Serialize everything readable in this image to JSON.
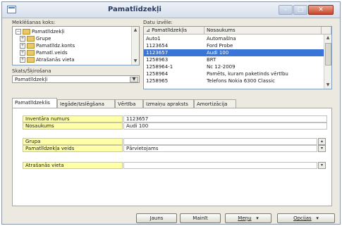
{
  "window": {
    "title": "Pamatlīdzekļi"
  },
  "left": {
    "tree_label": "Meklēšanas koks:",
    "tree_items": [
      {
        "label": "Pamatlīdzekļi",
        "expander": "−"
      },
      {
        "label": "Grupe",
        "expander": "+"
      },
      {
        "label": "Pamatlīdz.konts",
        "expander": "+"
      },
      {
        "label": "Pamatl.veids",
        "expander": "+"
      },
      {
        "label": "Atrašanās vieta",
        "expander": "+"
      }
    ],
    "sort_label": "Skats/Šķirošana",
    "sort_value": "Pamatlīdzekļi"
  },
  "list": {
    "label": "Datu izvēle:",
    "headers": [
      "Pamatlīdzekļis",
      "Nosaukums"
    ],
    "rows": [
      {
        "id": "Auto1",
        "name": "Automašīna"
      },
      {
        "id": "1123654",
        "name": "Ford Probe"
      },
      {
        "id": "1123657",
        "name": "Audi 100"
      },
      {
        "id": "1258963",
        "name": "BRT"
      },
      {
        "id": "1258964-1",
        "name": "Nc 12-2009"
      },
      {
        "id": "1258964",
        "name": "Pamēts, kuram paketinds vērtību"
      },
      {
        "id": "1258965",
        "name": "Telefons Nokia 6300 Classic"
      }
    ]
  },
  "tabs": [
    "Pamatlīdzeklis",
    "Iegāde/Izslēgšana",
    "Vērtība",
    "Izmaiņu apraksts",
    "Amortizācija"
  ],
  "form": {
    "fields": [
      {
        "label": "Inventāra numurs",
        "value": "1123657"
      },
      {
        "label": "Nosaukums",
        "value": "Audi 100"
      },
      {
        "label": "Grupa",
        "value": ""
      },
      {
        "label": "Pamatlīdzekļa veids",
        "value": "Pārvietojams"
      },
      {
        "label": "Atrašanās vieta",
        "value": ""
      }
    ]
  },
  "buttons": {
    "new": "Jauns",
    "delete": "Mainīt",
    "menu": "Meņu",
    "options": "Opcijas"
  },
  "colors": {
    "selection": "#3875d7",
    "label_bg": "#ffffa8",
    "title_text": "#2a3b63"
  }
}
